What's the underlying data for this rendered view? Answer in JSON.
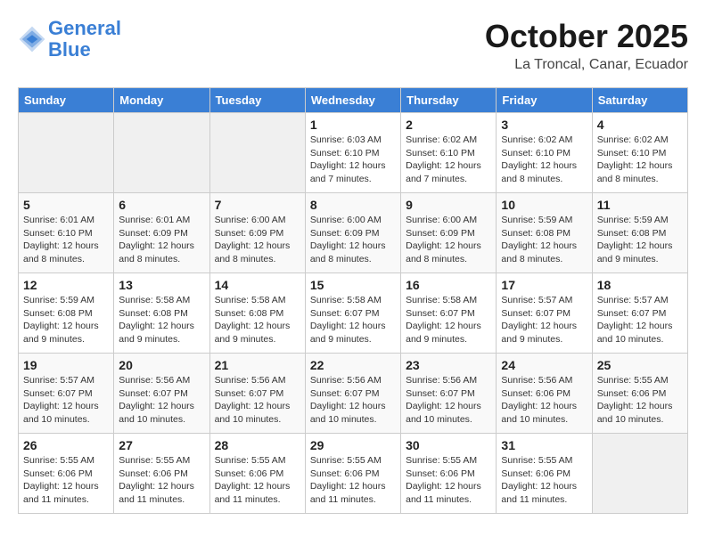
{
  "logo": {
    "line1": "General",
    "line2": "Blue"
  },
  "title": "October 2025",
  "location": "La Troncal, Canar, Ecuador",
  "weekdays": [
    "Sunday",
    "Monday",
    "Tuesday",
    "Wednesday",
    "Thursday",
    "Friday",
    "Saturday"
  ],
  "weeks": [
    [
      {
        "day": "",
        "sunrise": "",
        "sunset": "",
        "daylight": ""
      },
      {
        "day": "",
        "sunrise": "",
        "sunset": "",
        "daylight": ""
      },
      {
        "day": "",
        "sunrise": "",
        "sunset": "",
        "daylight": ""
      },
      {
        "day": "1",
        "sunrise": "Sunrise: 6:03 AM",
        "sunset": "Sunset: 6:10 PM",
        "daylight": "Daylight: 12 hours and 7 minutes."
      },
      {
        "day": "2",
        "sunrise": "Sunrise: 6:02 AM",
        "sunset": "Sunset: 6:10 PM",
        "daylight": "Daylight: 12 hours and 7 minutes."
      },
      {
        "day": "3",
        "sunrise": "Sunrise: 6:02 AM",
        "sunset": "Sunset: 6:10 PM",
        "daylight": "Daylight: 12 hours and 8 minutes."
      },
      {
        "day": "4",
        "sunrise": "Sunrise: 6:02 AM",
        "sunset": "Sunset: 6:10 PM",
        "daylight": "Daylight: 12 hours and 8 minutes."
      }
    ],
    [
      {
        "day": "5",
        "sunrise": "Sunrise: 6:01 AM",
        "sunset": "Sunset: 6:10 PM",
        "daylight": "Daylight: 12 hours and 8 minutes."
      },
      {
        "day": "6",
        "sunrise": "Sunrise: 6:01 AM",
        "sunset": "Sunset: 6:09 PM",
        "daylight": "Daylight: 12 hours and 8 minutes."
      },
      {
        "day": "7",
        "sunrise": "Sunrise: 6:00 AM",
        "sunset": "Sunset: 6:09 PM",
        "daylight": "Daylight: 12 hours and 8 minutes."
      },
      {
        "day": "8",
        "sunrise": "Sunrise: 6:00 AM",
        "sunset": "Sunset: 6:09 PM",
        "daylight": "Daylight: 12 hours and 8 minutes."
      },
      {
        "day": "9",
        "sunrise": "Sunrise: 6:00 AM",
        "sunset": "Sunset: 6:09 PM",
        "daylight": "Daylight: 12 hours and 8 minutes."
      },
      {
        "day": "10",
        "sunrise": "Sunrise: 5:59 AM",
        "sunset": "Sunset: 6:08 PM",
        "daylight": "Daylight: 12 hours and 8 minutes."
      },
      {
        "day": "11",
        "sunrise": "Sunrise: 5:59 AM",
        "sunset": "Sunset: 6:08 PM",
        "daylight": "Daylight: 12 hours and 9 minutes."
      }
    ],
    [
      {
        "day": "12",
        "sunrise": "Sunrise: 5:59 AM",
        "sunset": "Sunset: 6:08 PM",
        "daylight": "Daylight: 12 hours and 9 minutes."
      },
      {
        "day": "13",
        "sunrise": "Sunrise: 5:58 AM",
        "sunset": "Sunset: 6:08 PM",
        "daylight": "Daylight: 12 hours and 9 minutes."
      },
      {
        "day": "14",
        "sunrise": "Sunrise: 5:58 AM",
        "sunset": "Sunset: 6:08 PM",
        "daylight": "Daylight: 12 hours and 9 minutes."
      },
      {
        "day": "15",
        "sunrise": "Sunrise: 5:58 AM",
        "sunset": "Sunset: 6:07 PM",
        "daylight": "Daylight: 12 hours and 9 minutes."
      },
      {
        "day": "16",
        "sunrise": "Sunrise: 5:58 AM",
        "sunset": "Sunset: 6:07 PM",
        "daylight": "Daylight: 12 hours and 9 minutes."
      },
      {
        "day": "17",
        "sunrise": "Sunrise: 5:57 AM",
        "sunset": "Sunset: 6:07 PM",
        "daylight": "Daylight: 12 hours and 9 minutes."
      },
      {
        "day": "18",
        "sunrise": "Sunrise: 5:57 AM",
        "sunset": "Sunset: 6:07 PM",
        "daylight": "Daylight: 12 hours and 10 minutes."
      }
    ],
    [
      {
        "day": "19",
        "sunrise": "Sunrise: 5:57 AM",
        "sunset": "Sunset: 6:07 PM",
        "daylight": "Daylight: 12 hours and 10 minutes."
      },
      {
        "day": "20",
        "sunrise": "Sunrise: 5:56 AM",
        "sunset": "Sunset: 6:07 PM",
        "daylight": "Daylight: 12 hours and 10 minutes."
      },
      {
        "day": "21",
        "sunrise": "Sunrise: 5:56 AM",
        "sunset": "Sunset: 6:07 PM",
        "daylight": "Daylight: 12 hours and 10 minutes."
      },
      {
        "day": "22",
        "sunrise": "Sunrise: 5:56 AM",
        "sunset": "Sunset: 6:07 PM",
        "daylight": "Daylight: 12 hours and 10 minutes."
      },
      {
        "day": "23",
        "sunrise": "Sunrise: 5:56 AM",
        "sunset": "Sunset: 6:07 PM",
        "daylight": "Daylight: 12 hours and 10 minutes."
      },
      {
        "day": "24",
        "sunrise": "Sunrise: 5:56 AM",
        "sunset": "Sunset: 6:06 PM",
        "daylight": "Daylight: 12 hours and 10 minutes."
      },
      {
        "day": "25",
        "sunrise": "Sunrise: 5:55 AM",
        "sunset": "Sunset: 6:06 PM",
        "daylight": "Daylight: 12 hours and 10 minutes."
      }
    ],
    [
      {
        "day": "26",
        "sunrise": "Sunrise: 5:55 AM",
        "sunset": "Sunset: 6:06 PM",
        "daylight": "Daylight: 12 hours and 11 minutes."
      },
      {
        "day": "27",
        "sunrise": "Sunrise: 5:55 AM",
        "sunset": "Sunset: 6:06 PM",
        "daylight": "Daylight: 12 hours and 11 minutes."
      },
      {
        "day": "28",
        "sunrise": "Sunrise: 5:55 AM",
        "sunset": "Sunset: 6:06 PM",
        "daylight": "Daylight: 12 hours and 11 minutes."
      },
      {
        "day": "29",
        "sunrise": "Sunrise: 5:55 AM",
        "sunset": "Sunset: 6:06 PM",
        "daylight": "Daylight: 12 hours and 11 minutes."
      },
      {
        "day": "30",
        "sunrise": "Sunrise: 5:55 AM",
        "sunset": "Sunset: 6:06 PM",
        "daylight": "Daylight: 12 hours and 11 minutes."
      },
      {
        "day": "31",
        "sunrise": "Sunrise: 5:55 AM",
        "sunset": "Sunset: 6:06 PM",
        "daylight": "Daylight: 12 hours and 11 minutes."
      },
      {
        "day": "",
        "sunrise": "",
        "sunset": "",
        "daylight": ""
      }
    ]
  ]
}
